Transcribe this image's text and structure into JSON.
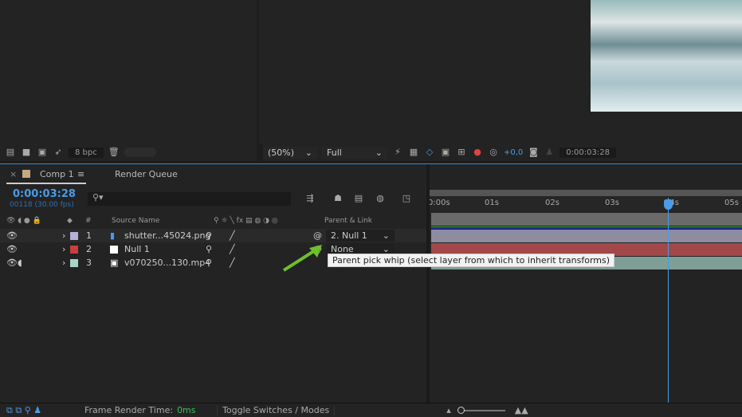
{
  "project_panel": {
    "bpc": "8 bpc"
  },
  "viewer": {
    "zoom": "(50%)",
    "resolution": "Full",
    "exposure": "+0,0",
    "timecode": "0:00:03:28"
  },
  "tabs": [
    {
      "label": "Comp 1"
    },
    {
      "label": "Render Queue"
    }
  ],
  "timeline": {
    "timecode": "0:00:03:28",
    "frame_info": "00118 (30.00 fps)",
    "search_placeholder": "",
    "headers": {
      "num": "#",
      "source_name": "Source Name",
      "parent": "Parent & Link"
    },
    "ruler": [
      "0:00s",
      "01s",
      "02s",
      "03s",
      "04s",
      "05s"
    ],
    "playhead_seconds": 3.93,
    "layers": [
      {
        "num": "1",
        "name": "shutter...45024.png",
        "label_color": "#b5b0d6",
        "parent": "2. Null 1",
        "bar_color": "#8f8ca0"
      },
      {
        "num": "2",
        "name": "Null 1",
        "label_color": "#c8403c",
        "parent": "None",
        "bar_color": "#a24848"
      },
      {
        "num": "3",
        "name": "v070250...130.mp4",
        "label_color": "#a9d3c8",
        "parent": "",
        "bar_color": "#7f9e96"
      }
    ]
  },
  "tooltip": "Parent pick whip (select layer from which to inherit transforms)",
  "status": {
    "render_label": "Frame Render Time:",
    "render_value": "0ms",
    "toggle": "Toggle Switches / Modes"
  }
}
